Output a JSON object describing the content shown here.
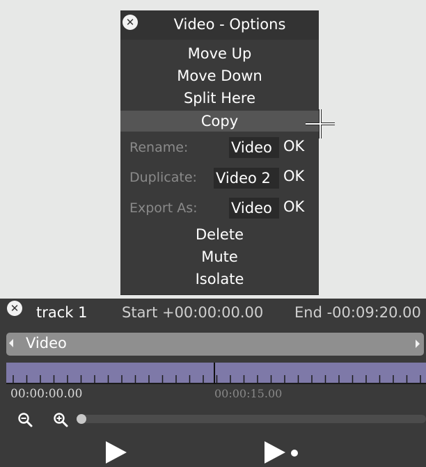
{
  "popup": {
    "close_icon": "close-icon",
    "title": "Video - Options",
    "menu": {
      "move_up": "Move Up",
      "move_down": "Move Down",
      "split_here": "Split Here",
      "copy": "Copy",
      "delete": "Delete",
      "mute": "Mute",
      "isolate": "Isolate"
    },
    "rename": {
      "label": "Rename:",
      "value": "Video",
      "ok": "OK"
    },
    "duplicate": {
      "label": "Duplicate:",
      "value": "Video 2",
      "ok": "OK"
    },
    "export": {
      "label": "Export As:",
      "value": "Video",
      "ok": "OK"
    }
  },
  "track": {
    "close_icon": "close-icon",
    "name": "track 1",
    "start": "Start +00:00:00.00",
    "end": "End -00:09:20.00",
    "clip_name": "Video",
    "timecodes": [
      "00:00:00.00",
      "00:00:15.00"
    ],
    "zoom_out_icon": "zoom-out-icon",
    "zoom_in_icon": "zoom-in-icon",
    "play_icon": "play-icon",
    "play_selection_icon": "play-selection-icon"
  },
  "colors": {
    "panel": "#3a3a3a",
    "background": "#e7e8e7",
    "timeline": "#7e79a8",
    "clip": "#8f8f8f"
  }
}
